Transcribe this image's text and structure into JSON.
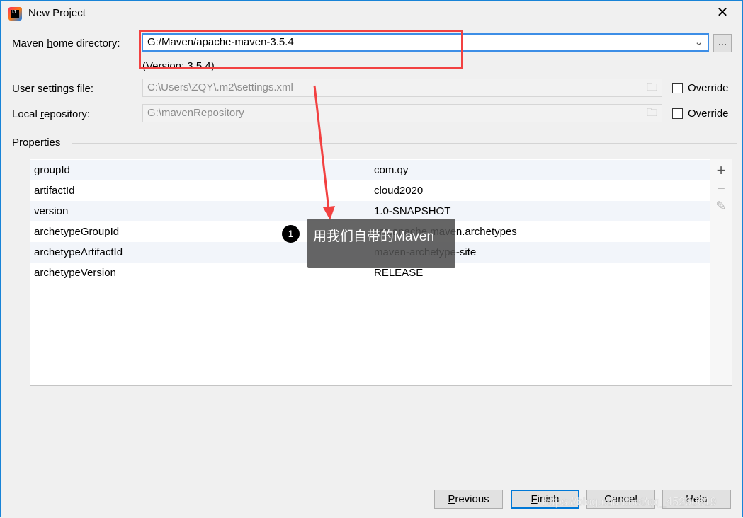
{
  "window": {
    "title": "New Project",
    "close": "✕"
  },
  "maven_home": {
    "label_pre": "Maven ",
    "label_u": "h",
    "label_post": "ome directory:",
    "value": "G:/Maven/apache-maven-3.5.4",
    "version": "(Version: 3.5.4)",
    "browse": "..."
  },
  "user_settings": {
    "label_pre": "User ",
    "label_u": "s",
    "label_post": "ettings file:",
    "value": "C:\\Users\\ZQY\\.m2\\settings.xml",
    "override": "Override",
    "checked": false
  },
  "local_repo": {
    "label_pre": "Local ",
    "label_u": "r",
    "label_post": "epository:",
    "value": "G:\\mavenRepository",
    "override": "Override",
    "checked": false
  },
  "properties": {
    "label": "Properties",
    "rows": [
      {
        "key": "groupId",
        "value": "com.qy"
      },
      {
        "key": "artifactId",
        "value": "cloud2020"
      },
      {
        "key": "version",
        "value": "1.0-SNAPSHOT"
      },
      {
        "key": "archetypeGroupId",
        "value": "org.apache.maven.archetypes"
      },
      {
        "key": "archetypeArtifactId",
        "value": "maven-archetype-site"
      },
      {
        "key": "archetypeVersion",
        "value": "RELEASE"
      }
    ],
    "tools": {
      "add": "+",
      "remove": "−",
      "edit": "✎"
    }
  },
  "buttons": {
    "previous_u": "P",
    "previous": "revious",
    "finish_u": "F",
    "finish": "inish",
    "cancel": "Cancel",
    "help": "Help"
  },
  "annotation": {
    "number": "1",
    "text": "用我们自带的Maven",
    "color": "#ff3b3b"
  },
  "watermark": "https://blog.csdn.net/qq_45260619"
}
